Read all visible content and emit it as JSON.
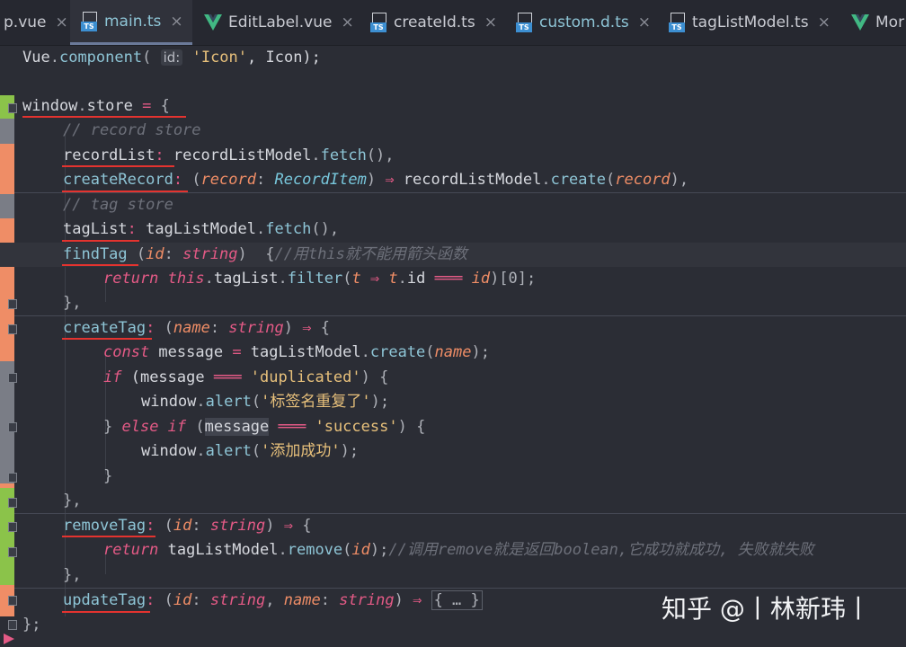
{
  "tabs": [
    {
      "label": "p.vue",
      "icon": "none",
      "active": false,
      "color": "#c9cbd2"
    },
    {
      "label": "main.ts",
      "icon": "ts-file-icon",
      "active": true,
      "color": "#8ec5d6"
    },
    {
      "label": "EditLabel.vue",
      "icon": "vue-icon",
      "active": false,
      "color": "#c9cbd2"
    },
    {
      "label": "createId.ts",
      "icon": "ts-file-icon",
      "active": false,
      "color": "#c9cbd2"
    },
    {
      "label": "custom.d.ts",
      "icon": "ts-file-icon",
      "active": false,
      "color": "#8ec5d6"
    },
    {
      "label": "tagListModel.ts",
      "icon": "ts-file-icon",
      "active": false,
      "color": "#c9cbd2"
    },
    {
      "label": "Mor",
      "icon": "vue-icon",
      "active": false,
      "color": "#c9cbd2"
    }
  ],
  "close_glyph": "×",
  "ts_badge": "TS",
  "code": {
    "l0": [
      "Vue",
      ".",
      "component",
      "(",
      "id:",
      "'Icon'",
      ", Icon);"
    ],
    "l2": [
      "window",
      ".",
      "store",
      " = ",
      "{"
    ],
    "l3": "// record store",
    "l4": [
      "recordList",
      ":",
      " recordListModel",
      ".",
      "fetch",
      "(),"
    ],
    "l5": [
      "createRecord",
      ":",
      " (",
      "record",
      ": ",
      "RecordItem",
      ") ",
      "⇒",
      " recordListModel",
      ".",
      "create",
      "(",
      "record",
      "),"
    ],
    "l6": "// tag store",
    "l7": [
      "tagList",
      ":",
      " tagListModel",
      ".",
      "fetch",
      "(),"
    ],
    "l8": [
      "findTag",
      " (",
      "id",
      ": ",
      "string",
      ")  {",
      "//用this就不能用箭头函数"
    ],
    "l9": [
      "return",
      " this",
      ".",
      "tagList",
      ".",
      "filter",
      "(",
      "t",
      " ⇒ ",
      "t",
      ".",
      "id",
      " ═══ ",
      "id",
      ")[0];"
    ],
    "l10": "},",
    "l11": [
      "createTag",
      ":",
      " (",
      "name",
      ": ",
      "string",
      ") ",
      "⇒",
      " {"
    ],
    "l12": [
      "const",
      " message",
      " = ",
      "tagListModel",
      ".",
      "create",
      "(",
      "name",
      ");"
    ],
    "l13": [
      "if",
      " (message",
      " ═══ ",
      "'duplicated'",
      ") {"
    ],
    "l14": [
      "window",
      ".",
      "alert",
      "(",
      "'标签名重复了'",
      ");"
    ],
    "l15": [
      "}",
      " else if",
      " (",
      "message",
      " ═══ ",
      "'success'",
      ") {"
    ],
    "l16": [
      "window",
      ".",
      "alert",
      "(",
      "'添加成功'",
      ");"
    ],
    "l17": "}",
    "l18": "},",
    "l19": [
      "removeTag",
      ":",
      " (",
      "id",
      ": ",
      "string",
      ") ",
      "⇒",
      " {"
    ],
    "l20": [
      "return",
      " tagListModel",
      ".",
      "remove",
      "(",
      "id",
      ");",
      "//调用remove就是返回boolean,它成功就成功, 失败就失败"
    ],
    "l21": "},",
    "l22": [
      "updateTag",
      ":",
      " (",
      "id",
      ": ",
      "string",
      ", ",
      "name",
      ": ",
      "string",
      ") ",
      "⇒",
      " ",
      "{ … }"
    ],
    "l23": "};"
  },
  "watermark": "知乎 @丨林新玮丨",
  "colors": {
    "accent": "#e45a86",
    "string": "#e7c07b",
    "underline": "#e4332f",
    "gutter_added": "#8bc34a",
    "gutter_modified": "#ef8d66",
    "gutter_neutral": "#7a7d86"
  }
}
